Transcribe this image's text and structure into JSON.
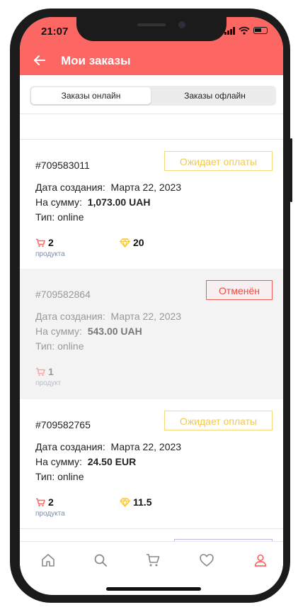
{
  "status_bar": {
    "time": "21:07"
  },
  "header": {
    "title": "Мои заказы"
  },
  "tabs": [
    {
      "label": "Заказы онлайн",
      "active": true
    },
    {
      "label": "Заказы офлайн",
      "active": false
    }
  ],
  "orders": [
    {
      "number": "#709583011",
      "status": "Ожидает оплаты",
      "created_label": "Дата создания:",
      "created_value": "Марта 22, 2023",
      "sum_label": "На сумму:",
      "sum_value": "1,073.00 UAH",
      "type_text": "Тип: online",
      "product_count": "2",
      "product_label": "продукта",
      "bonus": "20"
    },
    {
      "number": "#709582864",
      "status": "Отменён",
      "created_label": "Дата создания:",
      "created_value": "Марта 22, 2023",
      "sum_label": "На сумму:",
      "sum_value": "543.00 UAH",
      "type_text": "Тип: online",
      "product_count": "1",
      "product_label": "продукт"
    },
    {
      "number": "#709582765",
      "status": "Ожидает оплаты",
      "created_label": "Дата создания:",
      "created_value": "Марта 22, 2023",
      "sum_label": "На сумму:",
      "sum_value": "24.50 EUR",
      "type_text": "Тип: online",
      "product_count": "2",
      "product_label": "продукта",
      "bonus": "11.5"
    }
  ],
  "bottom_nav": [
    {
      "icon": "home-icon",
      "active": false
    },
    {
      "icon": "search-icon",
      "active": false
    },
    {
      "icon": "cart-icon",
      "active": false
    },
    {
      "icon": "heart-icon",
      "active": false
    },
    {
      "icon": "profile-icon",
      "active": true
    }
  ],
  "colors": {
    "accent": "#fd6763",
    "pending": "#f4c94a",
    "cancelled": "#ee4a44",
    "bonus_gem": "#f8c93c"
  }
}
